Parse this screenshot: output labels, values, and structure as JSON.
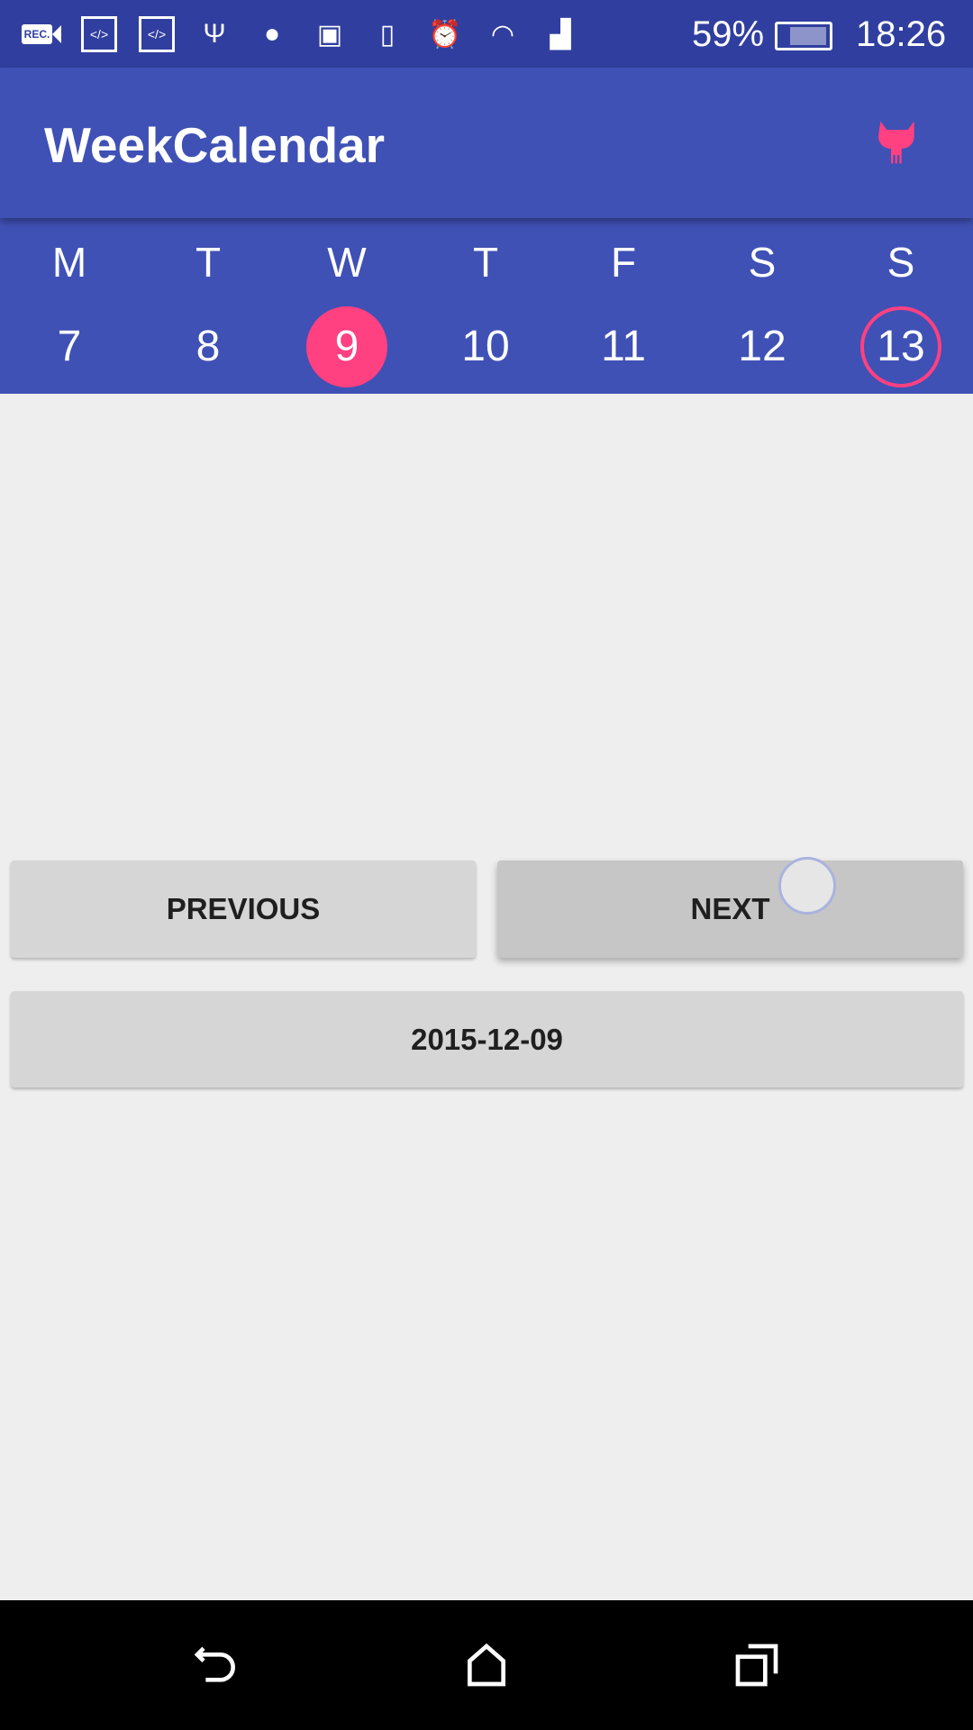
{
  "status_bar": {
    "icons": [
      "rec-icon",
      "code-icon",
      "code-icon",
      "usb-icon",
      "android-icon",
      "cast-icon",
      "vibrate-icon",
      "alarm-icon",
      "wifi-icon",
      "signal-icon"
    ],
    "rec_label": "REC.",
    "battery": "59%",
    "time": "18:26"
  },
  "app_bar": {
    "title": "WeekCalendar",
    "action_icon": "github-icon"
  },
  "week": {
    "days": [
      {
        "letter": "M",
        "date": "7"
      },
      {
        "letter": "T",
        "date": "8"
      },
      {
        "letter": "W",
        "date": "9",
        "selected": true
      },
      {
        "letter": "T",
        "date": "10"
      },
      {
        "letter": "F",
        "date": "11"
      },
      {
        "letter": "S",
        "date": "12"
      },
      {
        "letter": "S",
        "date": "13",
        "today": true
      }
    ]
  },
  "buttons": {
    "previous": "PREVIOUS",
    "next": "NEXT",
    "date": "2015-12-09"
  },
  "colors": {
    "primary": "#3f51b5",
    "primary_dark": "#303f9f",
    "accent": "#ff4081"
  }
}
